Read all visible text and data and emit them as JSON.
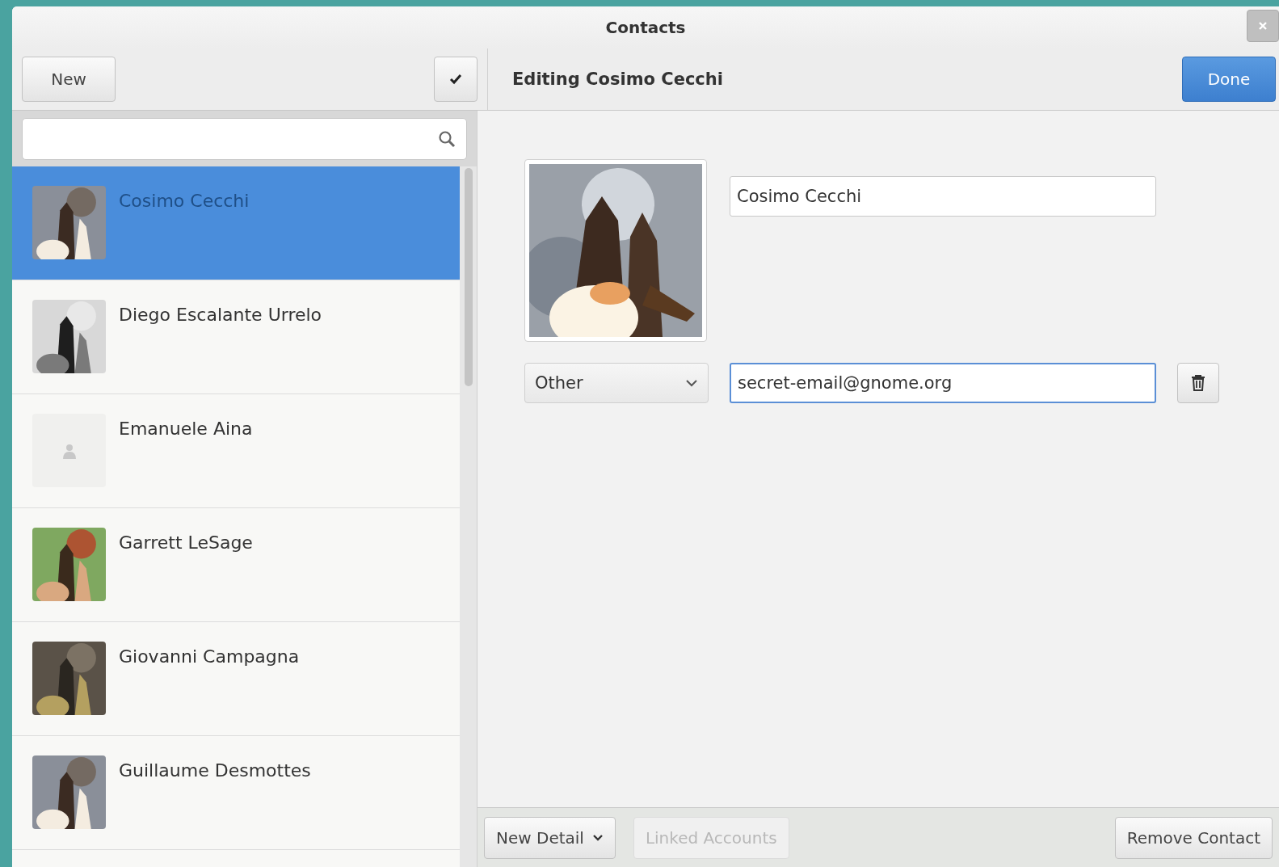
{
  "window": {
    "title": "Contacts"
  },
  "header": {
    "new_button": "New",
    "editing_title": "Editing Cosimo Cecchi",
    "done_button": "Done"
  },
  "contacts": [
    {
      "name": "Cosimo Cecchi",
      "selected": true
    },
    {
      "name": "Diego Escalante Urrelo",
      "selected": false
    },
    {
      "name": "Emanuele Aina",
      "selected": false,
      "kind": "placeholder"
    },
    {
      "name": "Garrett LeSage",
      "selected": false
    },
    {
      "name": "Giovanni Campagna",
      "selected": false
    },
    {
      "name": "Guillaume Desmottes",
      "selected": false
    }
  ],
  "editor": {
    "name_value": "Cosimo Cecchi",
    "detail_type": "Other",
    "detail_value": "secret-email@gnome.org"
  },
  "footer": [
    {
      "label": "New Detail",
      "disabled": false,
      "dropdown": true
    },
    {
      "label": "Linked Accounts",
      "disabled": true,
      "dropdown": false
    },
    {
      "label": "Remove Contact",
      "disabled": false,
      "dropdown": false
    }
  ]
}
